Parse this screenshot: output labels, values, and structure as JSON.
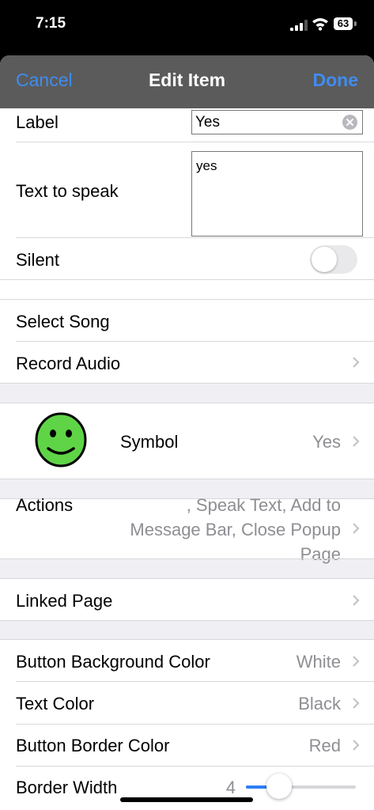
{
  "status": {
    "time": "7:15",
    "battery": "63"
  },
  "nav": {
    "cancel": "Cancel",
    "title": "Edit Item",
    "done": "Done"
  },
  "label": {
    "title": "Label",
    "value": "Yes"
  },
  "speak": {
    "title": "Text to speak",
    "value": "yes"
  },
  "silent": {
    "title": "Silent",
    "on": false
  },
  "song": {
    "title": "Select Song"
  },
  "record": {
    "title": "Record Audio"
  },
  "symbol": {
    "title": "Symbol",
    "value": "Yes"
  },
  "actions": {
    "title": "Actions",
    "line1": ", Speak Text, Add to",
    "line2": "Message Bar, Close Popup",
    "line3": "Page"
  },
  "linked": {
    "title": "Linked Page"
  },
  "bg_color": {
    "title": "Button Background Color",
    "value": "White"
  },
  "text_color": {
    "title": "Text Color",
    "value": "Black"
  },
  "border_color": {
    "title": "Button Border Color",
    "value": "Red"
  },
  "border_width": {
    "title": "Border Width",
    "value": "4"
  },
  "colors": {
    "accent": "#3f8cf0",
    "nav_bg": "#5b5b5b",
    "smiley": "#5fd447"
  }
}
